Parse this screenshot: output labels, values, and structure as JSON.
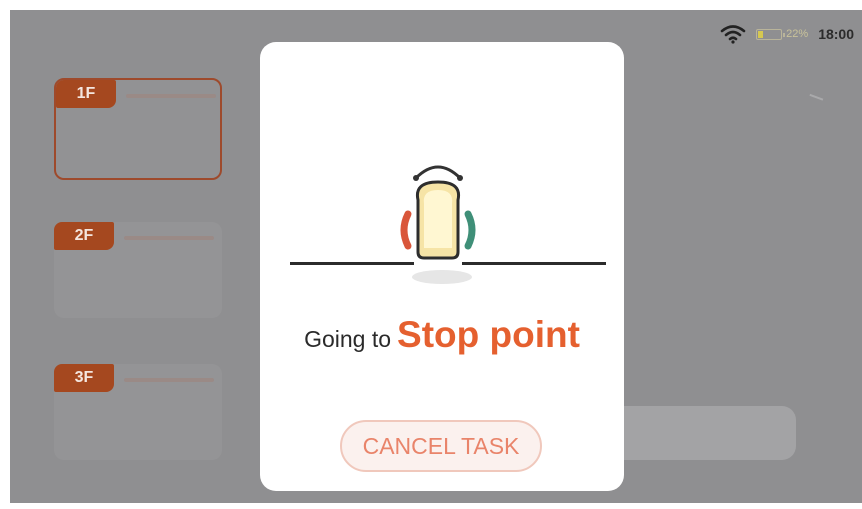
{
  "status_bar": {
    "battery_percent": "22%",
    "battery_level": 0.22,
    "time": "18:00",
    "wifi_icon": "wifi-icon",
    "battery_icon": "battery-icon"
  },
  "floors": [
    {
      "label": "1F",
      "selected": true
    },
    {
      "label": "2F",
      "selected": false
    },
    {
      "label": "3F",
      "selected": false
    }
  ],
  "dialog": {
    "prefix": "Going to",
    "destination": "Stop point",
    "cancel_label": "CANCEL TASK",
    "robot_icon": "delivery-robot-icon"
  },
  "colors": {
    "accent": "#e5602f",
    "floor_tag": "#a5481f",
    "overlay": "#8f8f91"
  }
}
